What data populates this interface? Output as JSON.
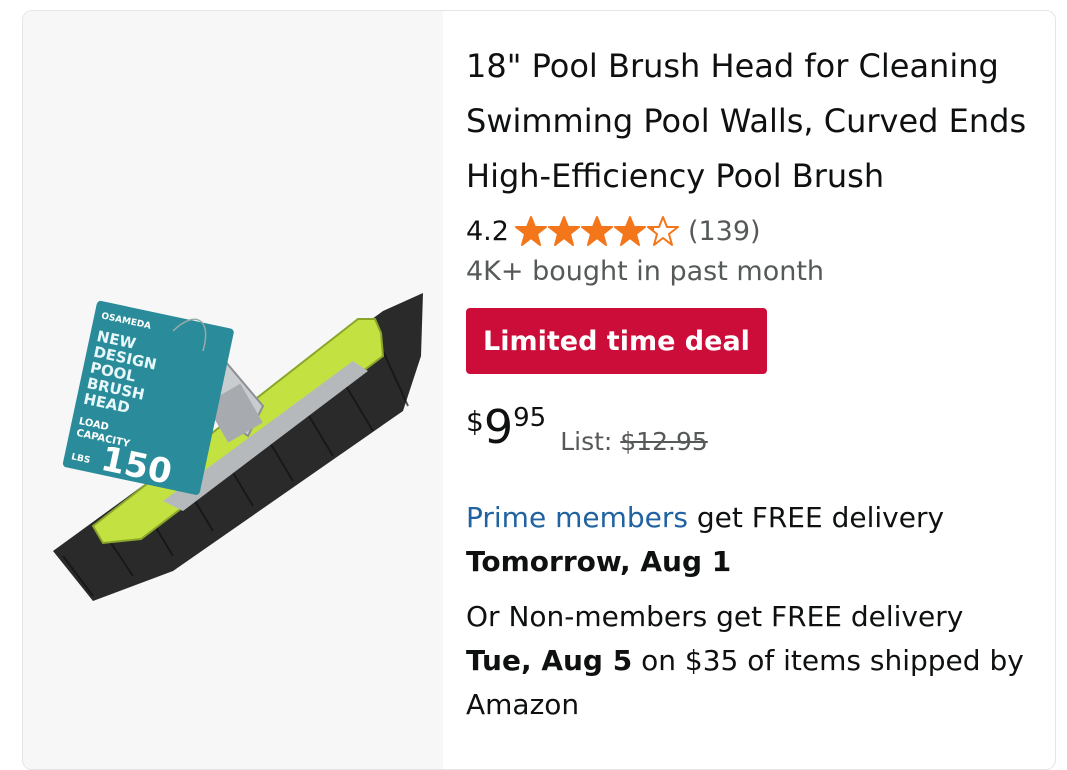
{
  "product": {
    "title": "18\" Pool Brush Head for Cleaning Swimming Pool Walls, Curved Ends High-Efficiency Pool Brush",
    "rating": "4.2",
    "stars_filled": 4.2,
    "review_count": "(139)",
    "bought_text": "4K+ bought in past month",
    "deal_badge": "Limited time deal",
    "price": {
      "symbol": "$",
      "whole": "9",
      "fraction": "95",
      "list_label": "List:",
      "list_value": "$12.95"
    },
    "image": {
      "tag_brand": "OSAMEDA",
      "tag_lines": [
        "NEW",
        "DESIGN",
        "POOL",
        "BRUSH",
        "HEAD"
      ],
      "tag_load": "LOAD",
      "tag_capacity": "CAPACITY",
      "tag_number": "150",
      "tag_unit": "LBS"
    }
  },
  "delivery": {
    "prime_link": "Prime members",
    "prime_text": " get FREE delivery",
    "prime_date": "Tomorrow, Aug 1",
    "nonmember_text": "Or Non-members get FREE delivery",
    "nonmember_date": "Tue, Aug 5",
    "nonmember_tail": " on $35 of items shipped by Amazon"
  },
  "colors": {
    "star": "#f3761a",
    "deal": "#cc0c39",
    "link": "#2162a1",
    "brush_green": "#c4e142"
  }
}
